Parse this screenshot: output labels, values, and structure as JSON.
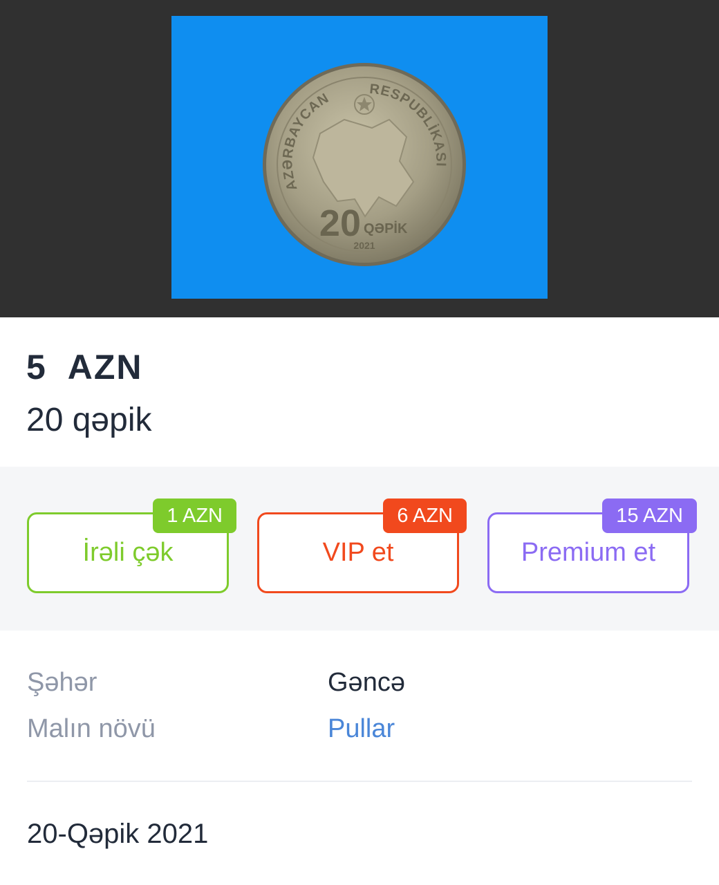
{
  "photo": {
    "backdrop_color": "#303030",
    "background_color": "#0f8ef0",
    "coin": {
      "rim_text_left": "AZƏRBAYCAN",
      "rim_text_right": "RESPUBLİKASI",
      "denomination": "20",
      "unit": "QƏPİK",
      "year": "2021"
    }
  },
  "listing": {
    "price": "5  AZN",
    "title": "20 qəpik"
  },
  "promotions": [
    {
      "label": "İrəli çək",
      "price": "1 AZN",
      "color": "#7ecb2c"
    },
    {
      "label": "VIP et",
      "price": "6 AZN",
      "color": "#f1491d"
    },
    {
      "label": "Premium et",
      "price": "15 AZN",
      "color": "#8b6bf3"
    }
  ],
  "properties": [
    {
      "label": "Şəhər",
      "value": "Gəncə"
    },
    {
      "label": "Malın növü",
      "value": "Pullar"
    }
  ],
  "description": "20-Qəpik 2021",
  "colors": {
    "text_primary": "#222b3a",
    "text_muted": "#8f97a8",
    "link": "#4a86d8",
    "promo_band": "#f5f6f8"
  }
}
